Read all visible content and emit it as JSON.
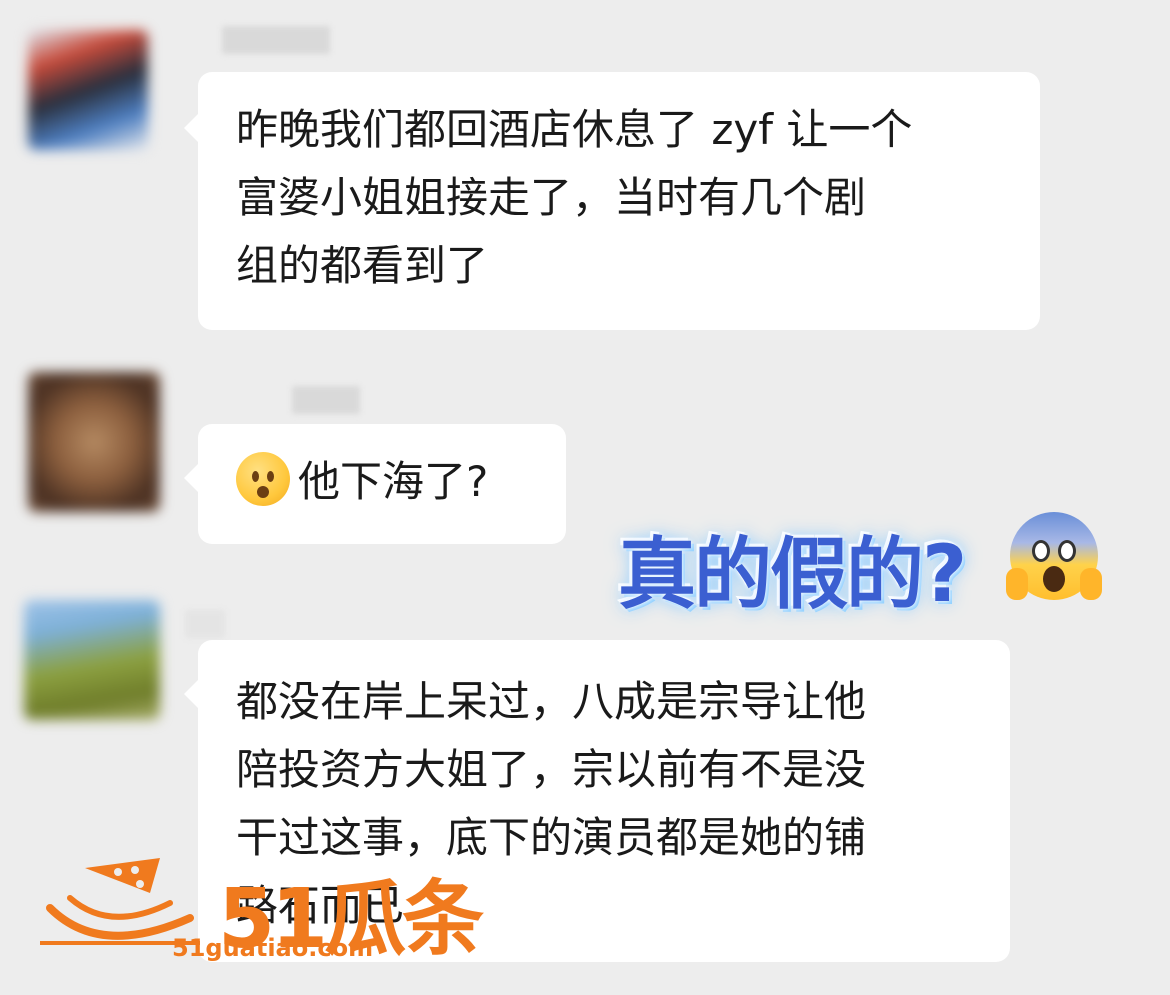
{
  "messages": [
    {
      "lines": [
        "昨晚我们都回酒店休息了 zyf 让一个",
        "富婆小姐姐接走了，当时有几个剧",
        "组的都看到了"
      ]
    },
    {
      "emoji": "worried-face-icon",
      "text": "他下海了?"
    },
    {
      "lines": [
        "都没在岸上呆过，八成是宗导让他",
        "陪投资方大姐了，宗以前有不是没",
        "干过这事，底下的演员都是她的铺",
        "路石而已"
      ]
    }
  ],
  "sticker": {
    "text": "真的假的?",
    "emoji": "screaming-face-icon"
  },
  "watermark": {
    "brand": "51瓜条",
    "url": "51guatiao.com",
    "color": "#f07a1e"
  },
  "colors": {
    "background": "#ededed",
    "bubble": "#ffffff",
    "text": "#1a1a1a",
    "sticker_text": "#3b5fd1"
  }
}
